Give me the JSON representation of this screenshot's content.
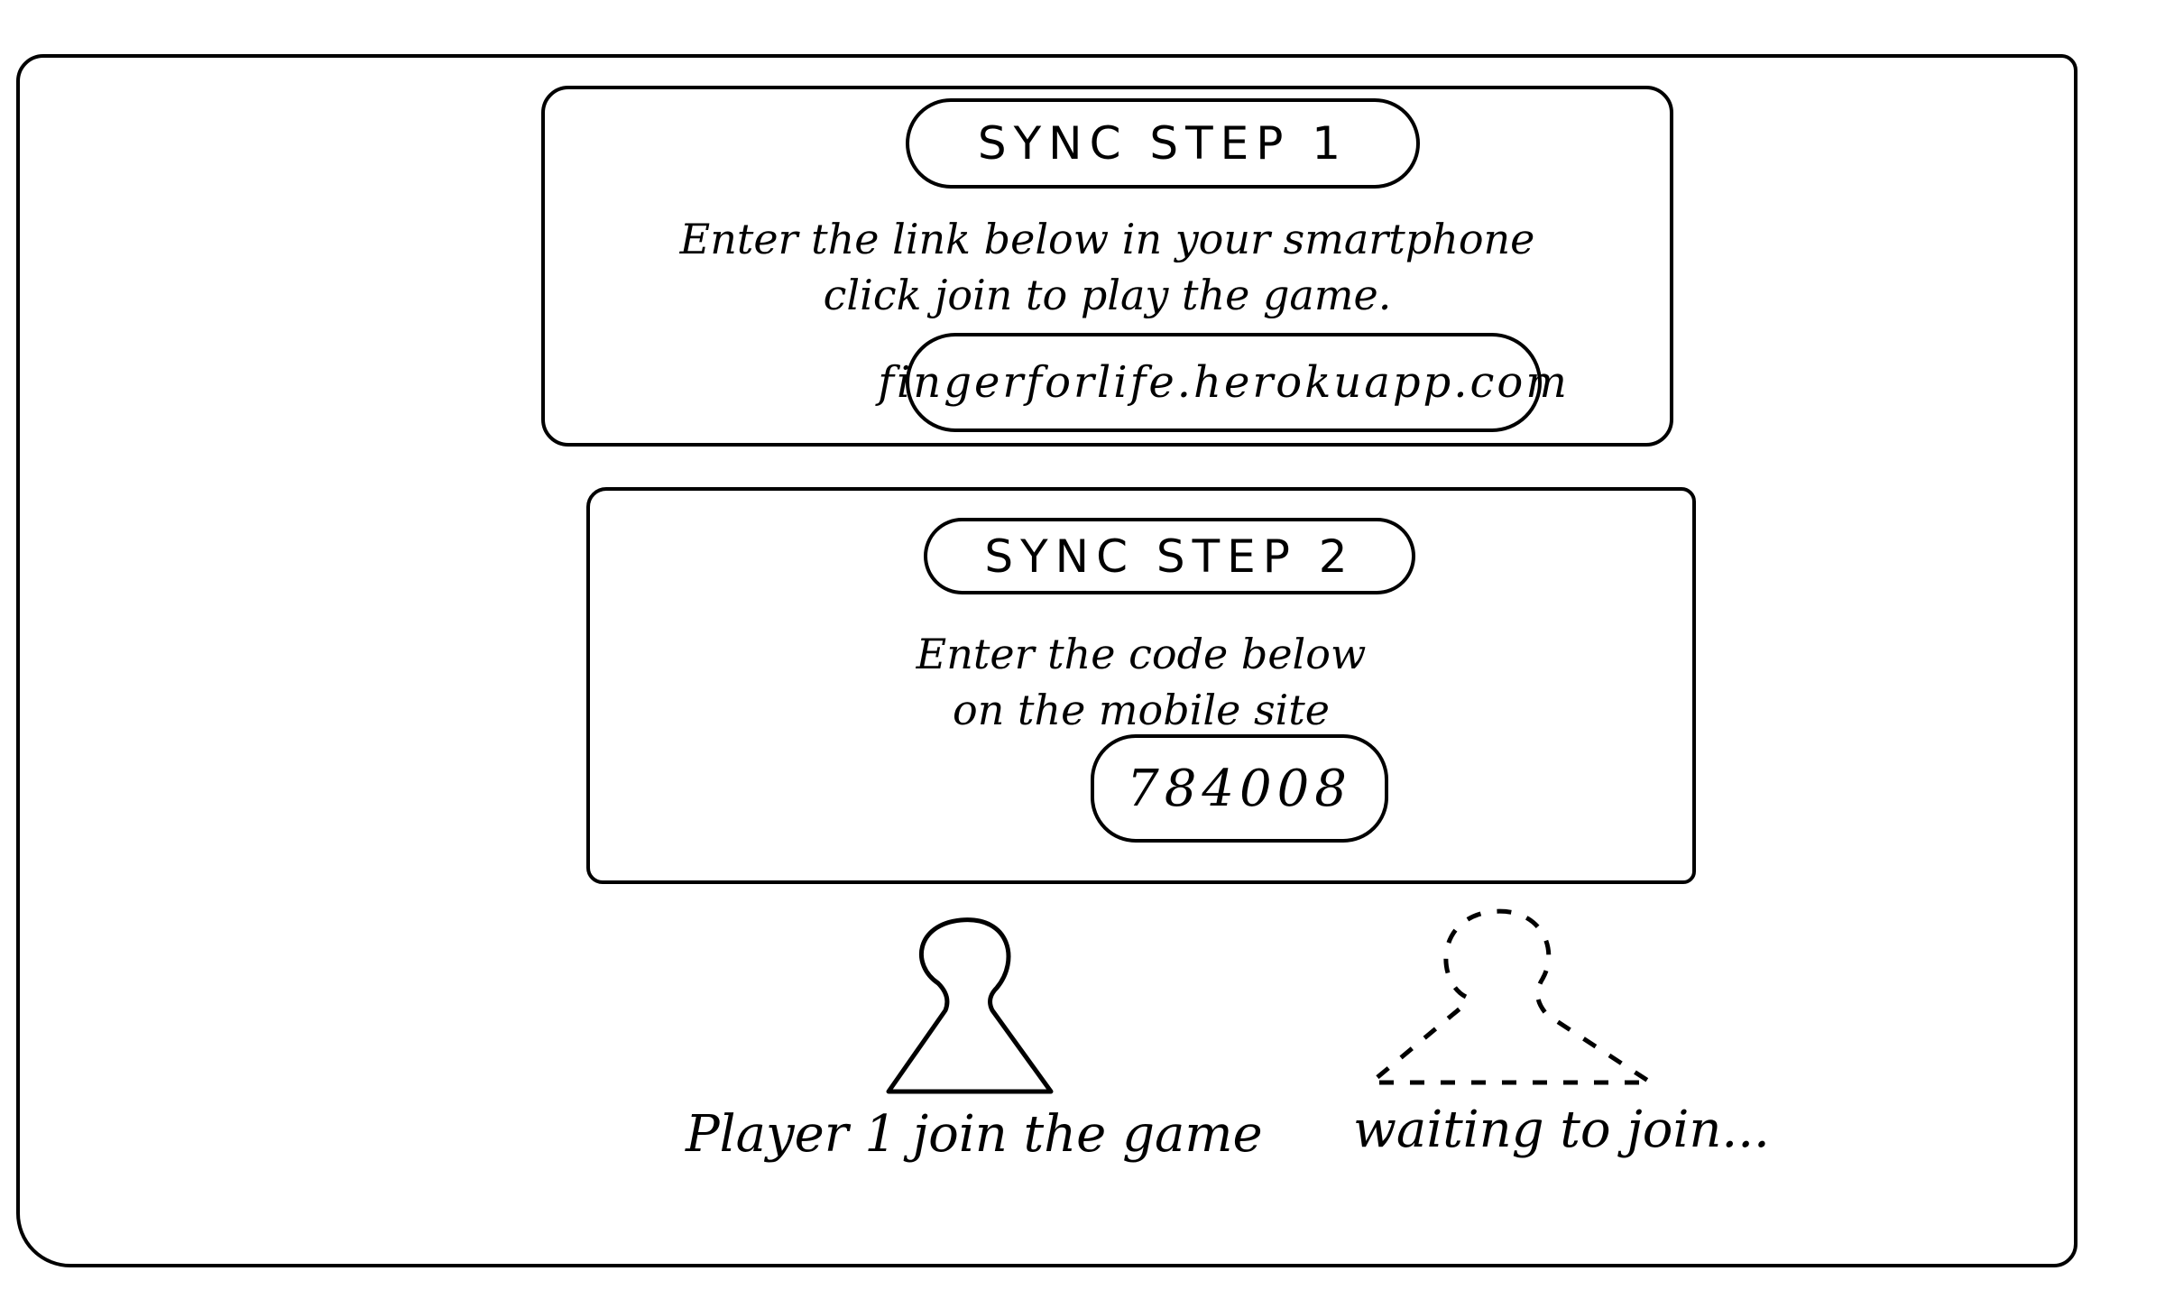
{
  "sync_step_1": {
    "title": "SYNC STEP 1",
    "instruction": "Enter the link below in your smartphone\nclick join to play the game.",
    "link": "fingerforlife.herokuapp.com"
  },
  "sync_step_2": {
    "title": "SYNC STEP 2",
    "instruction": "Enter the code below\non the mobile site",
    "code": "784008"
  },
  "players": {
    "player1": {
      "label": "Player 1 join the game",
      "icon": "person-icon",
      "state": "joined"
    },
    "player2": {
      "label": "waiting to join...",
      "icon": "person-placeholder-icon",
      "state": "waiting"
    }
  }
}
